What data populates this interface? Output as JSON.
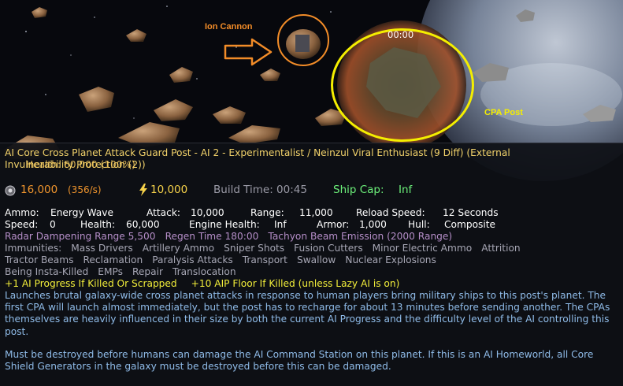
{
  "overlay": {
    "timer": "00:00",
    "ion_cannon_label": "Ion Cannon",
    "cpa_post_label": "CPA Post",
    "colors": {
      "annotation": "#f28c28",
      "highlight": "#f4ee00"
    }
  },
  "tooltip": {
    "title_line1": "AI Core Cross Planet Attack Guard Post - AI 2 - Experimentalist / Neinzul Viral Enthusiast (9 Diff) (External",
    "title_line2_a": "Invulnerability Protection (2))",
    "title_line2_b": "Health: 60,000 (100%)",
    "resources": {
      "metal": "16,000",
      "metal_rate": "(356/s)",
      "energy": "10,000",
      "build_time": "Build Time: 00:45",
      "ship_cap_label": "Ship Cap:",
      "ship_cap_value": "Inf"
    },
    "stats_row1": [
      "Ammo:",
      "Energy Wave",
      "Attack:",
      "10,000",
      "Range:",
      "11,000",
      "Reload Speed:",
      "12 Seconds"
    ],
    "stats_row2": [
      "Speed:",
      "0",
      "Health:",
      "60,000",
      "Engine Health:",
      "Inf",
      "Armor:",
      "1,000",
      "Hull:",
      "Composite"
    ],
    "abilities": [
      "Radar Dampening Range 5,500",
      "Regen Time 180:00",
      "Tachyon Beam Emission (2000 Range)"
    ],
    "immunities_1": [
      "Immunities:",
      "Mass Drivers",
      "Artillery Ammo",
      "Sniper Shots",
      "Fusion Cutters",
      "Minor Electric Ammo",
      "Attrition"
    ],
    "immunities_2": [
      "Tractor Beams",
      "Reclamation",
      "Paralysis Attacks",
      "Transport",
      "Swallow",
      "Nuclear Explosions"
    ],
    "immunities_3": [
      "Being Insta-Killed",
      "EMPs",
      "Repair",
      "Translocation"
    ],
    "ai_progress_1": "+1 AI Progress If Killed Or Scrapped",
    "ai_progress_2": "+10 AIP Floor If Killed (unless Lazy AI is on)",
    "description_1": "Launches brutal galaxy-wide cross planet attacks in response to human players bring military ships to this post's planet.  The first CPA will launch almost immediately, but the post has to recharge for about 13 minutes before sending another.  The CPAs themselves are heavily influenced in their size by both the current AI Progress and the difficulty level of the AI controlling this post.",
    "description_2": "Must be destroyed before humans can damage the AI Command Station on this planet.  If this is an AI Homeworld, all Core Shield Generators in the galaxy must be destroyed before this can be damaged.",
    "colors": {
      "title": "#f3d36b",
      "health": "#ffd060",
      "metal": "#f0952d",
      "energy": "#f6d24a",
      "ship_cap": "#6cf07a",
      "stat_label": "#ffffff",
      "ability": "#b58ec8",
      "immunity": "#a6a6b4",
      "ai_progress": "#f2ee3a",
      "description": "#8fbbe8"
    }
  }
}
